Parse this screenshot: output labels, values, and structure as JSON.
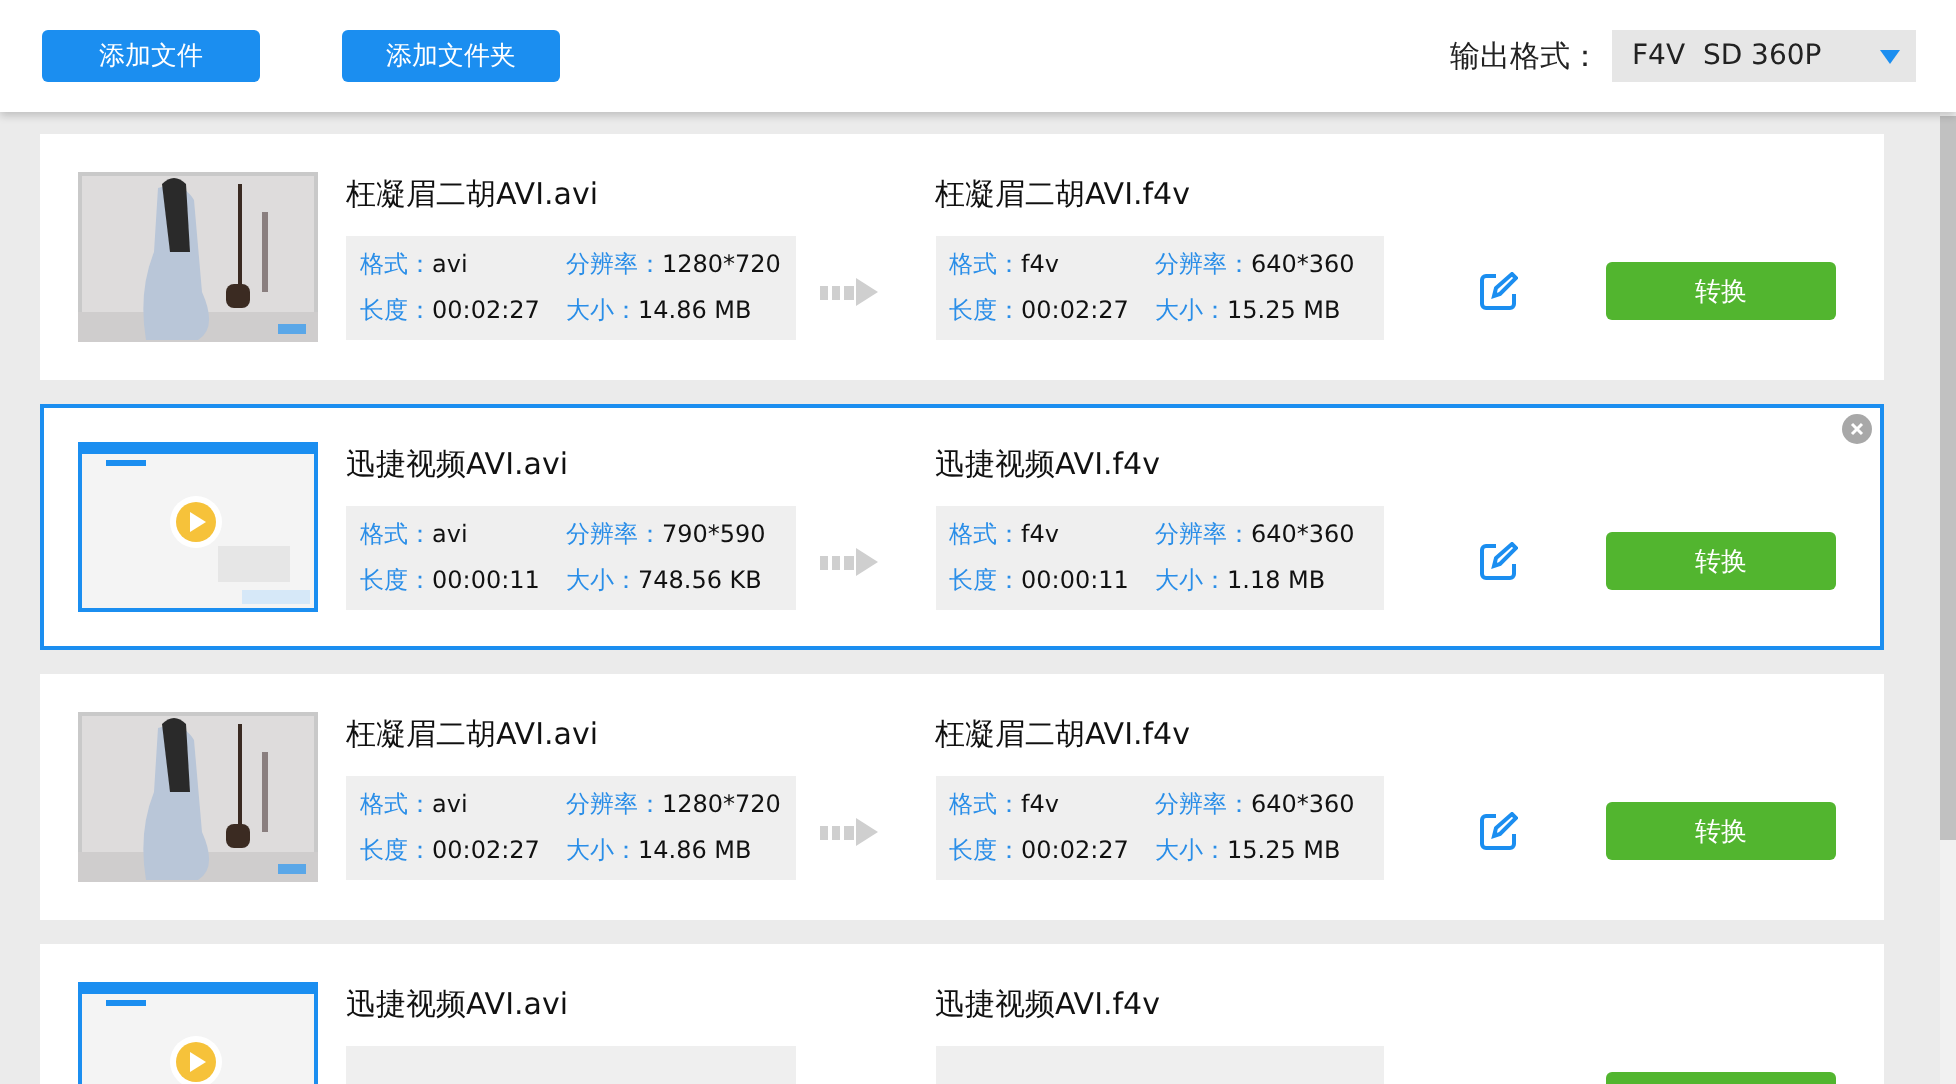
{
  "toolbar": {
    "buttons": [
      "添加文件",
      "添加文件夹"
    ],
    "format_label": "输出格式：",
    "format_value": "F4V  SD 360P"
  },
  "files": [
    {
      "selected": false,
      "source": {
        "name": "枉凝眉二胡AVI.avi",
        "info": [
          {
            "label": "格式：",
            "value": "avi"
          },
          {
            "label": "分辨率：",
            "value": "1280*720"
          },
          {
            "label": "长度：",
            "value": "00:02:27"
          },
          {
            "label": "大小：",
            "value": "14.86 MB"
          }
        ]
      },
      "target": {
        "name": "枉凝眉二胡AVI.f4v",
        "info": [
          {
            "label": "格式：",
            "value": "f4v"
          },
          {
            "label": "分辨率：",
            "value": "640*360"
          },
          {
            "label": "长度：",
            "value": "00:02:27"
          },
          {
            "label": "大小：",
            "value": "15.25 MB"
          }
        ]
      },
      "convert_label": "转换"
    },
    {
      "selected": true,
      "source": {
        "name": "迅捷视频AVI.avi",
        "info": [
          {
            "label": "格式：",
            "value": "avi"
          },
          {
            "label": "分辨率：",
            "value": "790*590"
          },
          {
            "label": "长度：",
            "value": "00:00:11"
          },
          {
            "label": "大小：",
            "value": "748.56 KB"
          }
        ]
      },
      "target": {
        "name": "迅捷视频AVI.f4v",
        "info": [
          {
            "label": "格式：",
            "value": "f4v"
          },
          {
            "label": "分辨率：",
            "value": "640*360"
          },
          {
            "label": "长度：",
            "value": "00:00:11"
          },
          {
            "label": "大小：",
            "value": "1.18 MB"
          }
        ]
      },
      "convert_label": "转换"
    },
    {
      "selected": false,
      "source": {
        "name": "枉凝眉二胡AVI.avi",
        "info": [
          {
            "label": "格式：",
            "value": "avi"
          },
          {
            "label": "分辨率：",
            "value": "1280*720"
          },
          {
            "label": "长度：",
            "value": "00:02:27"
          },
          {
            "label": "大小：",
            "value": "14.86 MB"
          }
        ]
      },
      "target": {
        "name": "枉凝眉二胡AVI.f4v",
        "info": [
          {
            "label": "格式：",
            "value": "f4v"
          },
          {
            "label": "分辨率：",
            "value": "640*360"
          },
          {
            "label": "长度：",
            "value": "00:02:27"
          },
          {
            "label": "大小：",
            "value": "15.25 MB"
          }
        ]
      },
      "convert_label": "转换"
    },
    {
      "selected": false,
      "source": {
        "name": "迅捷视频AVI.avi"
      },
      "target": {
        "name": "迅捷视频AVI.f4v"
      }
    }
  ]
}
